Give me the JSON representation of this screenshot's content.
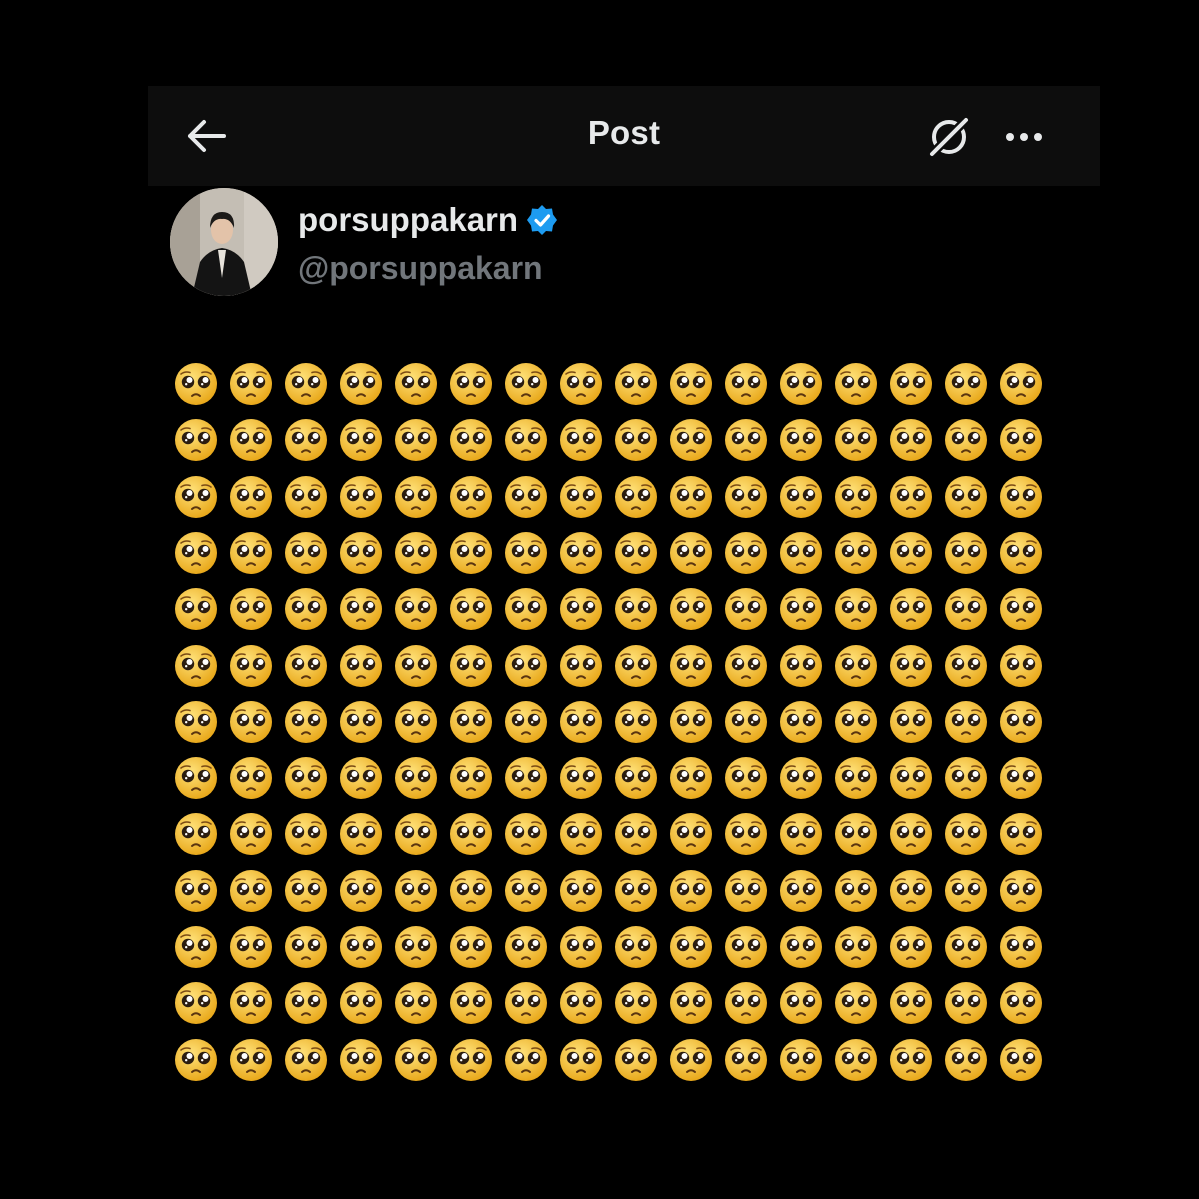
{
  "header": {
    "title": "Post",
    "back_icon": "arrow-left-icon",
    "grok_icon": "grok-icon",
    "more_icon": "more-horizontal-icon"
  },
  "author": {
    "display_name": "porsuppakarn",
    "handle": "@porsuppakarn",
    "verified": true
  },
  "post": {
    "emoji": "🥺",
    "emoji_icon": "pleading-face-icon",
    "columns": 16,
    "full_rows": 13,
    "partial_row_visible": true
  },
  "colors": {
    "background": "#000000",
    "header_bg": "#0d0d0d",
    "text_primary": "#e7e9ea",
    "text_secondary": "#71767b",
    "verified_blue": "#1d9bf0",
    "emoji_yellow": "#f5c02b"
  }
}
